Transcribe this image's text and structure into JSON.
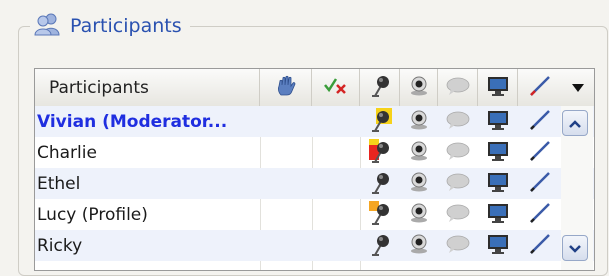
{
  "groupbox": {
    "title": "Participants",
    "title_icon": "people-icon"
  },
  "grid": {
    "columns": [
      {
        "key": "name",
        "label": "Participants"
      },
      {
        "key": "hand",
        "icon": "raised-hand-icon"
      },
      {
        "key": "answer",
        "icon": "yes-no-icon"
      },
      {
        "key": "audio",
        "icon": "microphone-icon"
      },
      {
        "key": "video",
        "icon": "webcam-icon"
      },
      {
        "key": "chat",
        "icon": "chat-bubble-icon"
      },
      {
        "key": "screen",
        "icon": "monitor-icon"
      },
      {
        "key": "whiteboard",
        "icon": "pencil-icon"
      }
    ],
    "menu_icon": "dropdown-arrow-icon",
    "rows": [
      {
        "name": "Vivian (Moderator...",
        "role": "moderator",
        "mic_state": "talking-yellow"
      },
      {
        "name": "Charlie",
        "role": "participant",
        "mic_state": "talking-red"
      },
      {
        "name": "Ethel",
        "role": "participant",
        "mic_state": "normal"
      },
      {
        "name": "Lucy (Profile)",
        "role": "participant",
        "mic_state": "talking-orange"
      },
      {
        "name": "Ricky",
        "role": "participant",
        "mic_state": "normal"
      }
    ]
  },
  "scrollbar": {
    "up_icon": "chevron-up-icon",
    "down_icon": "chevron-down-icon"
  },
  "colors": {
    "moderator_text": "#1f2ee0",
    "legend_text": "#2a51b0",
    "row_alt": "#eef2fb",
    "mic_yellow": "#f6d21a",
    "mic_red": "#e8251f",
    "mic_orange": "#f5a623"
  }
}
